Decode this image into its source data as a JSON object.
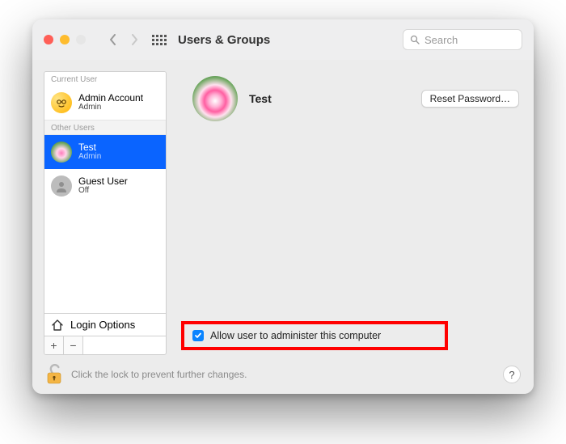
{
  "toolbar": {
    "title": "Users & Groups",
    "search_placeholder": "Search"
  },
  "sidebar": {
    "sections": [
      "Current User",
      "Other Users"
    ],
    "users": [
      {
        "name": "Admin Account",
        "role": "Admin"
      },
      {
        "name": "Test",
        "role": "Admin",
        "selected": true
      },
      {
        "name": "Guest User",
        "role": "Off"
      }
    ],
    "login_options": "Login Options",
    "add_label": "+",
    "remove_label": "−"
  },
  "detail": {
    "name": "Test",
    "reset_button": "Reset Password…",
    "admin_check_label": "Allow user to administer this computer",
    "admin_checked": true
  },
  "footer": {
    "lock_text": "Click the lock to prevent further changes.",
    "help_label": "?"
  }
}
